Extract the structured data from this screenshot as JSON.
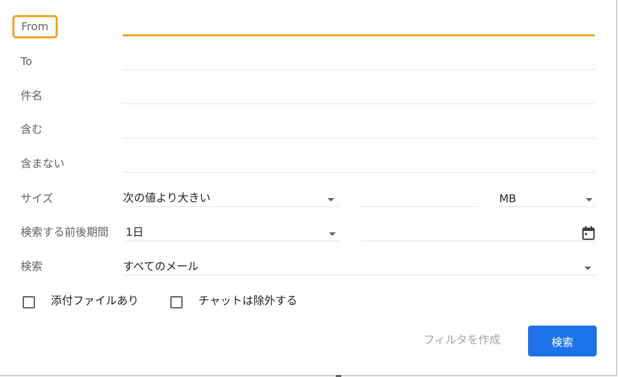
{
  "fields": {
    "from": {
      "label": "From",
      "value": ""
    },
    "to": {
      "label": "To",
      "value": ""
    },
    "subject": {
      "label": "件名",
      "value": ""
    },
    "has_words": {
      "label": "含む",
      "value": ""
    },
    "doesnt_have": {
      "label": "含まない",
      "value": ""
    }
  },
  "size": {
    "label": "サイズ",
    "operator": "次の値より大きい",
    "value": "",
    "unit": "MB"
  },
  "date_within": {
    "label": "検索する前後期間",
    "range": "1日",
    "date": ""
  },
  "search_in": {
    "label": "検索",
    "value": "すべてのメール"
  },
  "checkboxes": {
    "has_attachment": {
      "label": "添付ファイルあり",
      "checked": false
    },
    "exclude_chats": {
      "label": "チャットは除外する",
      "checked": false
    }
  },
  "actions": {
    "create_filter": "フィルタを作成",
    "search": "検索"
  },
  "colors": {
    "focus": "#f4a41d",
    "primary": "#1a73e8"
  }
}
